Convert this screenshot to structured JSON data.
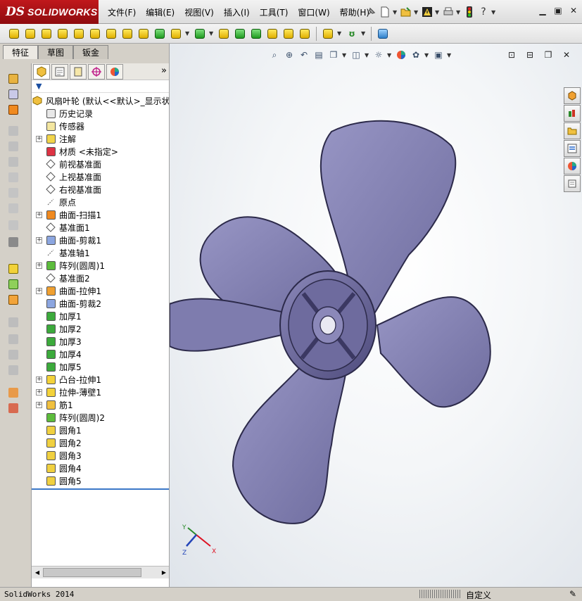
{
  "app": {
    "logo_prefix": "DS",
    "logo_name": "SOLIDWORKS"
  },
  "menu": [
    "文件(F)",
    "编辑(E)",
    "视图(V)",
    "插入(I)",
    "工具(T)",
    "窗口(W)",
    "帮助(H)"
  ],
  "command_manager_tabs": [
    "特征",
    "草图",
    "钣金"
  ],
  "feature_tree": {
    "root": "风扇叶轮 (默认<<默认>_显示状",
    "items": [
      {
        "label": "历史记录",
        "icon": "history-icon",
        "expandable": false
      },
      {
        "label": "传感器",
        "icon": "sensor-icon",
        "expandable": false
      },
      {
        "label": "注解",
        "icon": "annotation-icon",
        "expandable": true
      },
      {
        "label": "材质 <未指定>",
        "icon": "material-icon",
        "expandable": false
      },
      {
        "label": "前视基准面",
        "icon": "plane-icon",
        "expandable": false
      },
      {
        "label": "上视基准面",
        "icon": "plane-icon",
        "expandable": false
      },
      {
        "label": "右视基准面",
        "icon": "plane-icon",
        "expandable": false
      },
      {
        "label": "原点",
        "icon": "origin-icon",
        "expandable": false
      },
      {
        "label": "曲面-扫描1",
        "icon": "surface-sweep-icon",
        "expandable": true
      },
      {
        "label": "基准面1",
        "icon": "plane-icon",
        "expandable": false
      },
      {
        "label": "曲面-剪裁1",
        "icon": "surface-trim-icon",
        "expandable": true
      },
      {
        "label": "基准轴1",
        "icon": "axis-icon",
        "expandable": false
      },
      {
        "label": "阵列(圆周)1",
        "icon": "circular-pattern-icon",
        "expandable": true
      },
      {
        "label": "基准面2",
        "icon": "plane-icon",
        "expandable": false
      },
      {
        "label": "曲面-拉伸1",
        "icon": "surface-extrude-icon",
        "expandable": true
      },
      {
        "label": "曲面-剪裁2",
        "icon": "surface-trim-icon",
        "expandable": false
      },
      {
        "label": "加厚1",
        "icon": "thicken-icon",
        "expandable": false
      },
      {
        "label": "加厚2",
        "icon": "thicken-icon",
        "expandable": false
      },
      {
        "label": "加厚3",
        "icon": "thicken-icon",
        "expandable": false
      },
      {
        "label": "加厚4",
        "icon": "thicken-icon",
        "expandable": false
      },
      {
        "label": "加厚5",
        "icon": "thicken-icon",
        "expandable": false
      },
      {
        "label": "凸台-拉伸1",
        "icon": "boss-extrude-icon",
        "expandable": true
      },
      {
        "label": "拉伸-薄壁1",
        "icon": "thin-extrude-icon",
        "expandable": true
      },
      {
        "label": "筋1",
        "icon": "rib-icon",
        "expandable": true
      },
      {
        "label": "阵列(圆周)2",
        "icon": "circular-pattern-icon",
        "expandable": false
      },
      {
        "label": "圆角1",
        "icon": "fillet-icon",
        "expandable": false
      },
      {
        "label": "圆角2",
        "icon": "fillet-icon",
        "expandable": false
      },
      {
        "label": "圆角3",
        "icon": "fillet-icon",
        "expandable": false
      },
      {
        "label": "圆角4",
        "icon": "fillet-icon",
        "expandable": false
      },
      {
        "label": "圆角5",
        "icon": "fillet-icon",
        "expandable": false
      }
    ]
  },
  "status": {
    "app_version": "SolidWorks 2014",
    "units": "自定义"
  },
  "triad": {
    "x": "X",
    "y": "Y",
    "z": "Z"
  },
  "colors": {
    "blade": "#7c7aab",
    "hub": "#6d6a9c",
    "logo_red": "#b3151a",
    "accent_blue": "#3c78c8"
  }
}
